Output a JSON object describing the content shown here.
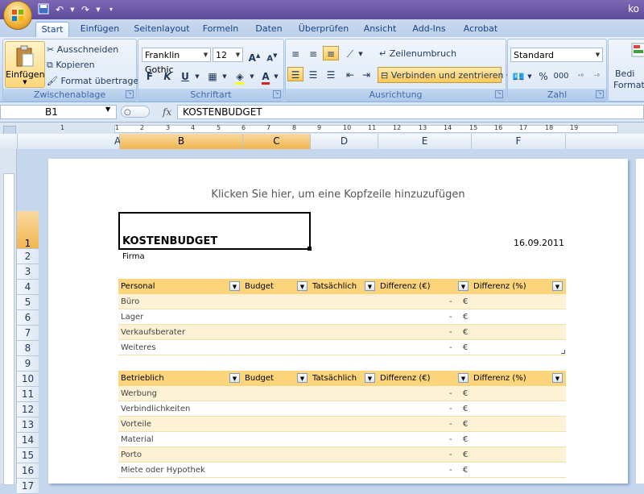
{
  "window": {
    "title": "ko"
  },
  "ribbon_tabs": [
    "Start",
    "Einfügen",
    "Seitenlayout",
    "Formeln",
    "Daten",
    "Überprüfen",
    "Ansicht",
    "Add-Ins",
    "Acrobat"
  ],
  "clipboard": {
    "paste": "Einfügen",
    "cut": "Ausschneiden",
    "copy": "Kopieren",
    "format_painter": "Format übertragen",
    "label": "Zwischenablage"
  },
  "font": {
    "name": "Franklin Gothic",
    "size": "12",
    "bold": "F",
    "italic": "K",
    "underline": "U",
    "label": "Schriftart"
  },
  "alignment": {
    "wrap": "Zeilenumbruch",
    "merge": "Verbinden und zentrieren",
    "label": "Ausrichtung"
  },
  "number": {
    "format": "Standard",
    "percent": "%",
    "thousands": "000",
    "label": "Zahl"
  },
  "styles": {
    "label": "Bedi",
    "label2": "Formatie"
  },
  "formula_bar": {
    "cell": "B1",
    "fx": "fx",
    "content": "KOSTENBUDGET"
  },
  "columns": [
    "A",
    "B",
    "C",
    "D",
    "E",
    "F"
  ],
  "rows": [
    "1",
    "2",
    "3",
    "4",
    "5",
    "6",
    "7",
    "8",
    "9",
    "10",
    "11",
    "12",
    "13",
    "14",
    "15",
    "16",
    "17"
  ],
  "ruler_numbers": [
    "1",
    "1",
    "2",
    "3",
    "4",
    "5",
    "6",
    "7",
    "8",
    "9",
    "10",
    "11",
    "12",
    "13",
    "14",
    "15",
    "16",
    "17",
    "18",
    "19"
  ],
  "page": {
    "header_hint": "Klicken Sie hier, um eine Kopfzeile hinzuzufügen",
    "title": "KOSTENBUDGET",
    "date": "16.09.2011",
    "company": "Firma"
  },
  "table_personal": {
    "headers": [
      "Personal",
      "Budget",
      "Tatsächlich",
      "Differenz (€)",
      "Differenz (%)"
    ],
    "rows": [
      "Büro",
      "Lager",
      "Verkaufsberater",
      "Weiteres"
    ]
  },
  "table_operating": {
    "headers": [
      "Betrieblich",
      "Budget",
      "Tatsächlich",
      "Differenz (€)",
      "Differenz (%)"
    ],
    "rows": [
      "Werbung",
      "Verbindlichkeiten",
      "Vorteile",
      "Material",
      "Porto",
      "Miete oder Hypothek"
    ]
  },
  "cell_dash": "-",
  "cell_currency": "€",
  "colors": {
    "table_header": "#fcd47c",
    "table_band": "#fdf1d6",
    "selection": "#f1b64e",
    "ribbon": "#c9dbf2"
  }
}
